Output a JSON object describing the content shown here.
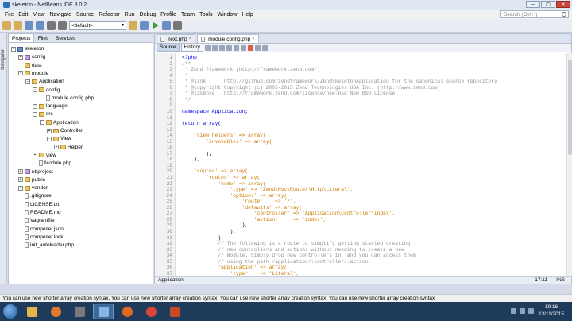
{
  "window": {
    "title": "skeleton - NetBeans IDE 8.0.2"
  },
  "menu": [
    "File",
    "Edit",
    "View",
    "Navigate",
    "Source",
    "Refactor",
    "Run",
    "Debug",
    "Profile",
    "Team",
    "Tools",
    "Window",
    "Help"
  ],
  "search": {
    "placeholder": "Search (Ctrl+I)"
  },
  "toolbar": {
    "config": "<default>"
  },
  "left_strip": {
    "label": "Navigator"
  },
  "project_panel": {
    "tabs": [
      "Projects",
      "Files",
      "Services"
    ],
    "tree": [
      {
        "label": "skeleton",
        "depth": 0,
        "toggle": "-",
        "kind": "proj"
      },
      {
        "label": "config",
        "depth": 1,
        "toggle": "+",
        "kind": "pkg"
      },
      {
        "label": "data",
        "depth": 1,
        "toggle": "",
        "kind": "folder"
      },
      {
        "label": "module",
        "depth": 1,
        "toggle": "-",
        "kind": "folder"
      },
      {
        "label": "Application",
        "depth": 2,
        "toggle": "-",
        "kind": "folder"
      },
      {
        "label": "config",
        "depth": 3,
        "toggle": "-",
        "kind": "folder"
      },
      {
        "label": "module.config.php",
        "depth": 4,
        "toggle": "",
        "kind": "file"
      },
      {
        "label": "language",
        "depth": 3,
        "toggle": "+",
        "kind": "folder"
      },
      {
        "label": "src",
        "depth": 3,
        "toggle": "-",
        "kind": "folder"
      },
      {
        "label": "Application",
        "depth": 4,
        "toggle": "-",
        "kind": "folder"
      },
      {
        "label": "Controller",
        "depth": 5,
        "toggle": "+",
        "kind": "folder"
      },
      {
        "label": "View",
        "depth": 5,
        "toggle": "-",
        "kind": "folder"
      },
      {
        "label": "Helper",
        "depth": 6,
        "toggle": "+",
        "kind": "folder"
      },
      {
        "label": "view",
        "depth": 3,
        "toggle": "+",
        "kind": "folder"
      },
      {
        "label": "Module.php",
        "depth": 3,
        "toggle": "",
        "kind": "file"
      },
      {
        "label": "nbproject",
        "depth": 1,
        "toggle": "+",
        "kind": "pkg"
      },
      {
        "label": "public",
        "depth": 1,
        "toggle": "+",
        "kind": "folder"
      },
      {
        "label": "vendor",
        "depth": 1,
        "toggle": "+",
        "kind": "folder"
      },
      {
        "label": ".gitignore",
        "depth": 1,
        "toggle": "",
        "kind": "file"
      },
      {
        "label": "LICENSE.txt",
        "depth": 1,
        "toggle": "",
        "kind": "file"
      },
      {
        "label": "README.md",
        "depth": 1,
        "toggle": "",
        "kind": "file"
      },
      {
        "label": "Vagrantfile",
        "depth": 1,
        "toggle": "",
        "kind": "file"
      },
      {
        "label": "composer.json",
        "depth": 1,
        "toggle": "",
        "kind": "file"
      },
      {
        "label": "composer.lock",
        "depth": 1,
        "toggle": "",
        "kind": "file"
      },
      {
        "label": "init_autoloader.php",
        "depth": 1,
        "toggle": "",
        "kind": "file"
      }
    ]
  },
  "editor": {
    "tabs": [
      {
        "label": "Text.php",
        "active": false
      },
      {
        "label": "module.config.php",
        "active": true
      }
    ],
    "source_tab": "Source",
    "history_tab": "History",
    "breadcrumb": "Application",
    "position": "17:11",
    "mode": "INS",
    "first_line": 1,
    "lines": [
      "<?php",
      "/**",
      " * Zend Framework (http://framework.zend.com/)",
      " *",
      " * @link      http://github.com/zendframework/ZendSkeletonApplication for the canonical source repository",
      " * @copyright Copyright (c) 2005-2015 Zend Technologies USA Inc. (http://www.zend.com)",
      " * @license   http://framework.zend.com/license/new-bsd New BSD License",
      " */",
      "",
      "namespace Application;",
      "",
      "return array(",
      "",
      "    'view_helpers' => array(",
      "        'invokables' => array(",
      "",
      "        ),",
      "    ),",
      "",
      "    'router' => array(",
      "        'routes' => array(",
      "            'home' => array(",
      "                'type' => 'Zend\\Mvc\\Router\\Http\\Literal',",
      "                'options' => array(",
      "                    'route'    => '/',",
      "                    'defaults' => array(",
      "                        'controller' => 'Application\\Controller\\Index',",
      "                        'action'     => 'index',",
      "                    ),",
      "                ),",
      "            ),",
      "            // The following is a route to simplify getting started creating",
      "            // new controllers and actions without needing to create a new",
      "            // module. Simply drop new controllers in, and you can access them",
      "            // using the path /application/:controller/:action",
      "            'application' => array(",
      "                'type'    => 'Literal',"
    ]
  },
  "status_bar": {
    "text": "You can use new shorter array creation syntax. You can use new shorter array creation syntax. You can use new shorter array creation syntax. You can use new shorter array creation syntax"
  },
  "taskbar": {
    "time": "19:16",
    "date": "13/11/2015"
  }
}
